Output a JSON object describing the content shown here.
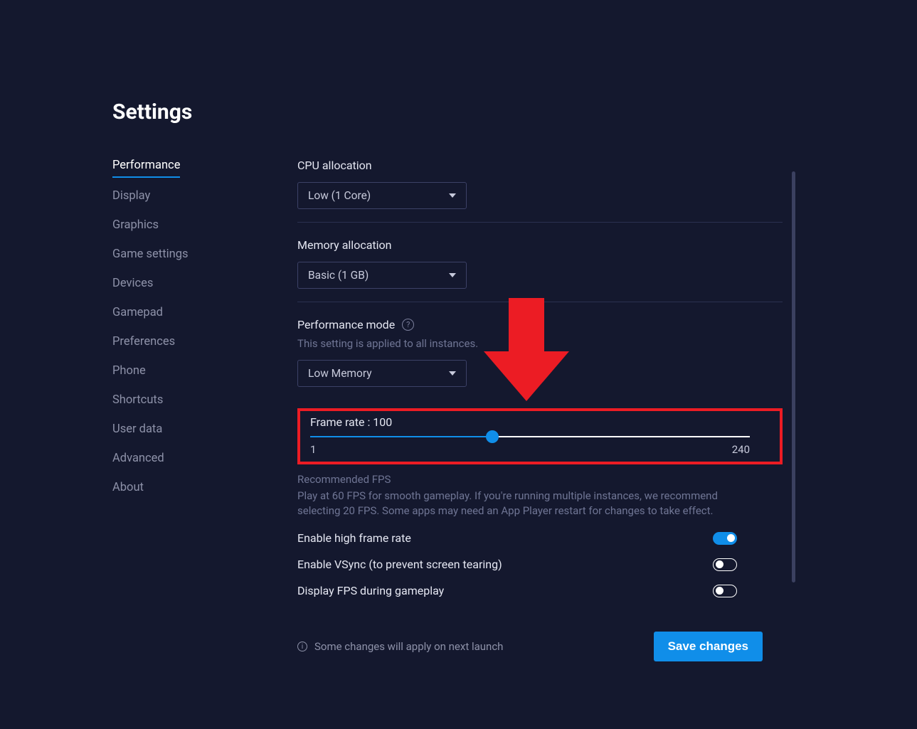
{
  "page_title": "Settings",
  "sidebar": {
    "items": [
      {
        "label": "Performance",
        "active": true
      },
      {
        "label": "Display",
        "active": false
      },
      {
        "label": "Graphics",
        "active": false
      },
      {
        "label": "Game settings",
        "active": false
      },
      {
        "label": "Devices",
        "active": false
      },
      {
        "label": "Gamepad",
        "active": false
      },
      {
        "label": "Preferences",
        "active": false
      },
      {
        "label": "Phone",
        "active": false
      },
      {
        "label": "Shortcuts",
        "active": false
      },
      {
        "label": "User data",
        "active": false
      },
      {
        "label": "Advanced",
        "active": false
      },
      {
        "label": "About",
        "active": false
      }
    ]
  },
  "cpu": {
    "label": "CPU allocation",
    "value": "Low (1 Core)"
  },
  "memory": {
    "label": "Memory allocation",
    "value": "Basic (1 GB)"
  },
  "perf_mode": {
    "label": "Performance mode",
    "subtext": "This setting is applied to all instances.",
    "value": "Low Memory"
  },
  "frame_rate": {
    "label_prefix": "Frame rate : ",
    "value": 100,
    "min": 1,
    "max": 240,
    "min_label": "1",
    "max_label": "240"
  },
  "recommend": {
    "title": "Recommended FPS",
    "text": "Play at 60 FPS for smooth gameplay. If you're running multiple instances, we recommend selecting 20 FPS. Some apps may need an App Player restart for changes to take effect."
  },
  "toggles": {
    "high_frame": {
      "label": "Enable high frame rate",
      "on": true
    },
    "vsync": {
      "label": "Enable VSync (to prevent screen tearing)",
      "on": false
    },
    "show_fps": {
      "label": "Display FPS during gameplay",
      "on": false
    }
  },
  "footer": {
    "note": "Some changes will apply on next launch",
    "save": "Save changes"
  },
  "annotation": {
    "color": "#ec1c24"
  }
}
